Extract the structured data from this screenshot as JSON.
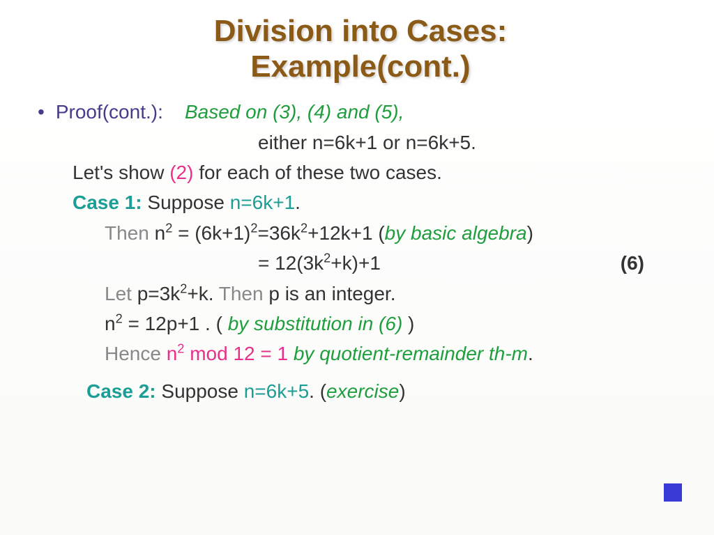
{
  "title_l1": "Division into Cases:",
  "title_l2": "Example(cont.)",
  "proof_label": "Proof(cont.):",
  "based_on": "Based on (3), (4) and (5),",
  "either_line": "either n=6k+1 or n=6k+5.",
  "lets_a": "Let",
  "lets_apos": "'",
  "lets_b": "s show ",
  "lets_ref": "(2)",
  "lets_c": " for each of these two cases.",
  "case1_label": "Case 1:",
  "suppose": "  Suppose ",
  "case1_eq": "n=6k+1",
  "then": "Then",
  "line_eq1_a": " n",
  "line_eq1_b": " = (6k+1)",
  "line_eq1_c": "=36k",
  "line_eq1_d": "+12k+1  (",
  "by_alg": "by basic algebra",
  "close_paren": ")",
  "line_eq2_a": "= 12(3k",
  "line_eq2_b": "+k)+1",
  "eqnum6": "(6)",
  "let_word": "Let",
  "let_line_a": " p=3k",
  "let_line_b": "+k.  ",
  "then2": "Then",
  "let_line_c": " p is an integer.",
  "sub_line_a": "n",
  "sub_line_b": " = 12p+1 .  ( ",
  "by_sub": "by substitution in (6)",
  "sub_line_c": " )",
  "hence": "Hence",
  "result_a": " n",
  "result_b": " mod 12 = 1 ",
  "by_qr": "by quotient-remainder th-m",
  "period": ".",
  "case2_label": "Case 2:",
  "case2_eq": "n=6k+5",
  "case2_after": ".  (",
  "exercise": "exercise"
}
